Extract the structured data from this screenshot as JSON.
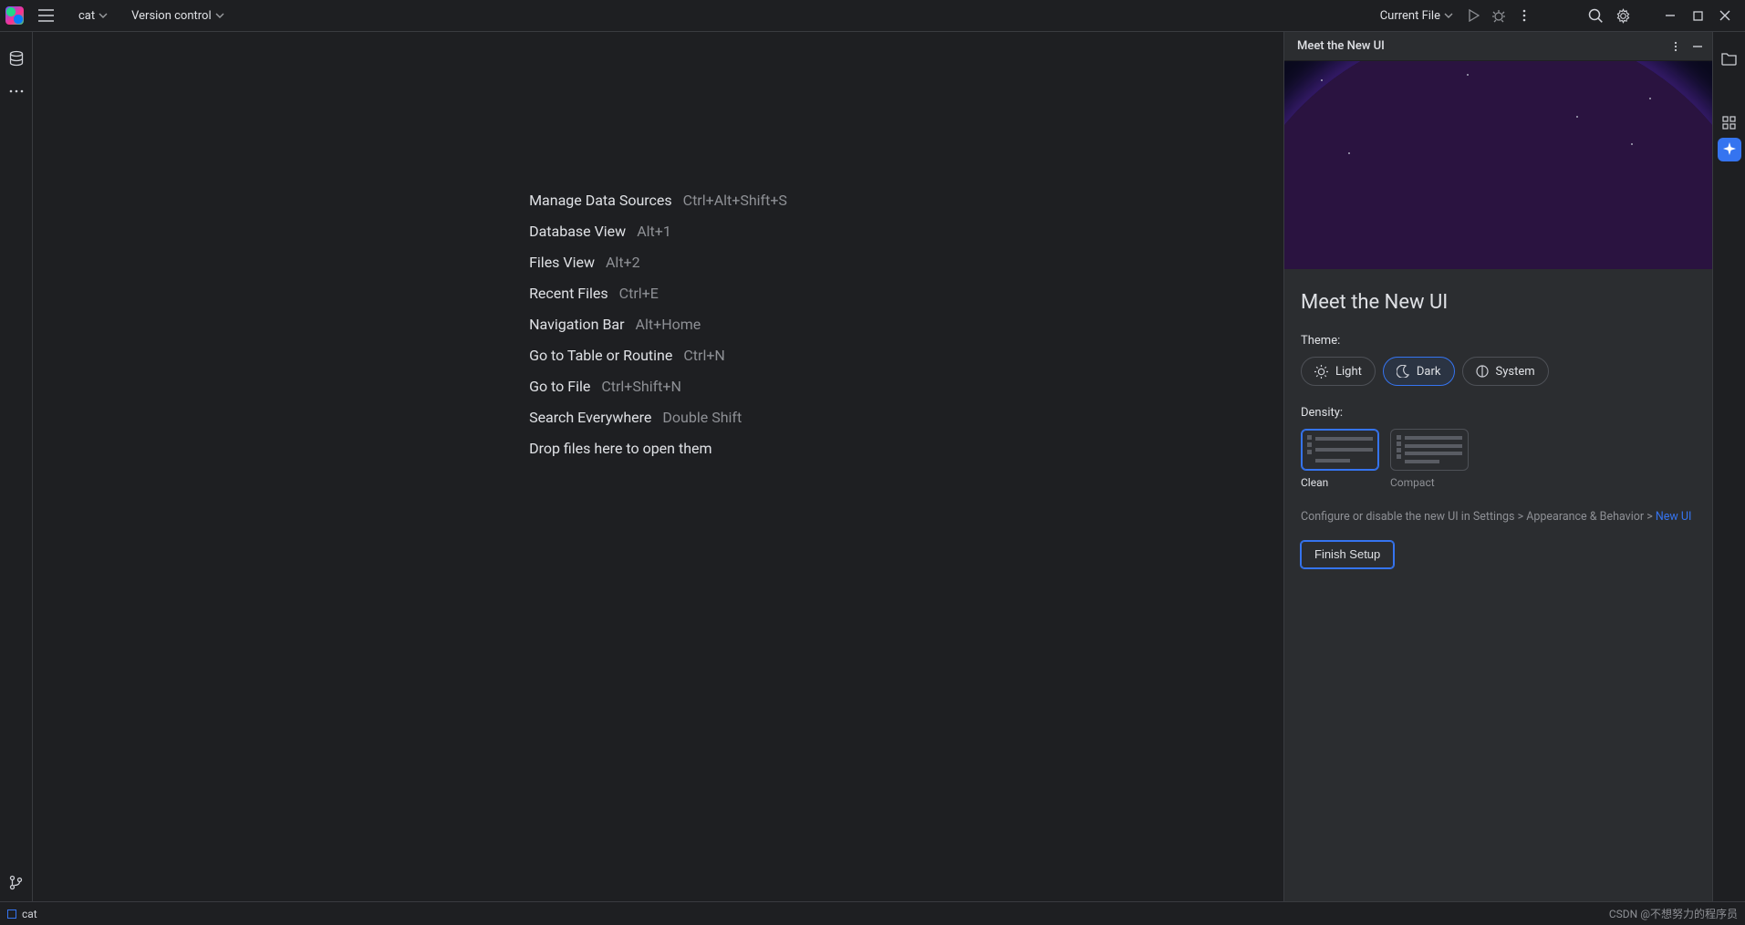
{
  "titlebar": {
    "project_label": "cat",
    "vcs_label": "Version control",
    "run_config_label": "Current File"
  },
  "editor_actions": [
    {
      "name": "Manage Data Sources",
      "shortcut": "Ctrl+Alt+Shift+S"
    },
    {
      "name": "Database View",
      "shortcut": "Alt+1"
    },
    {
      "name": "Files View",
      "shortcut": "Alt+2"
    },
    {
      "name": "Recent Files",
      "shortcut": "Ctrl+E"
    },
    {
      "name": "Navigation Bar",
      "shortcut": "Alt+Home"
    },
    {
      "name": "Go to Table or Routine",
      "shortcut": "Ctrl+N"
    },
    {
      "name": "Go to File",
      "shortcut": "Ctrl+Shift+N"
    },
    {
      "name": "Search Everywhere",
      "shortcut": "Double Shift"
    }
  ],
  "editor_drop_hint": "Drop files here to open them",
  "panel": {
    "tab_title": "Meet the New UI",
    "heading": "Meet the New UI",
    "theme_label": "Theme:",
    "themes": {
      "light": "Light",
      "dark": "Dark",
      "system": "System"
    },
    "density_label": "Density:",
    "density_clean": "Clean",
    "density_compact": "Compact",
    "hint_prefix": "Configure or disable the new UI in Settings > Appearance & Behavior > ",
    "hint_link": "New UI",
    "finish_label": "Finish Setup"
  },
  "statusbar": {
    "project": "cat",
    "watermark": "CSDN @不想努力的程序员"
  }
}
